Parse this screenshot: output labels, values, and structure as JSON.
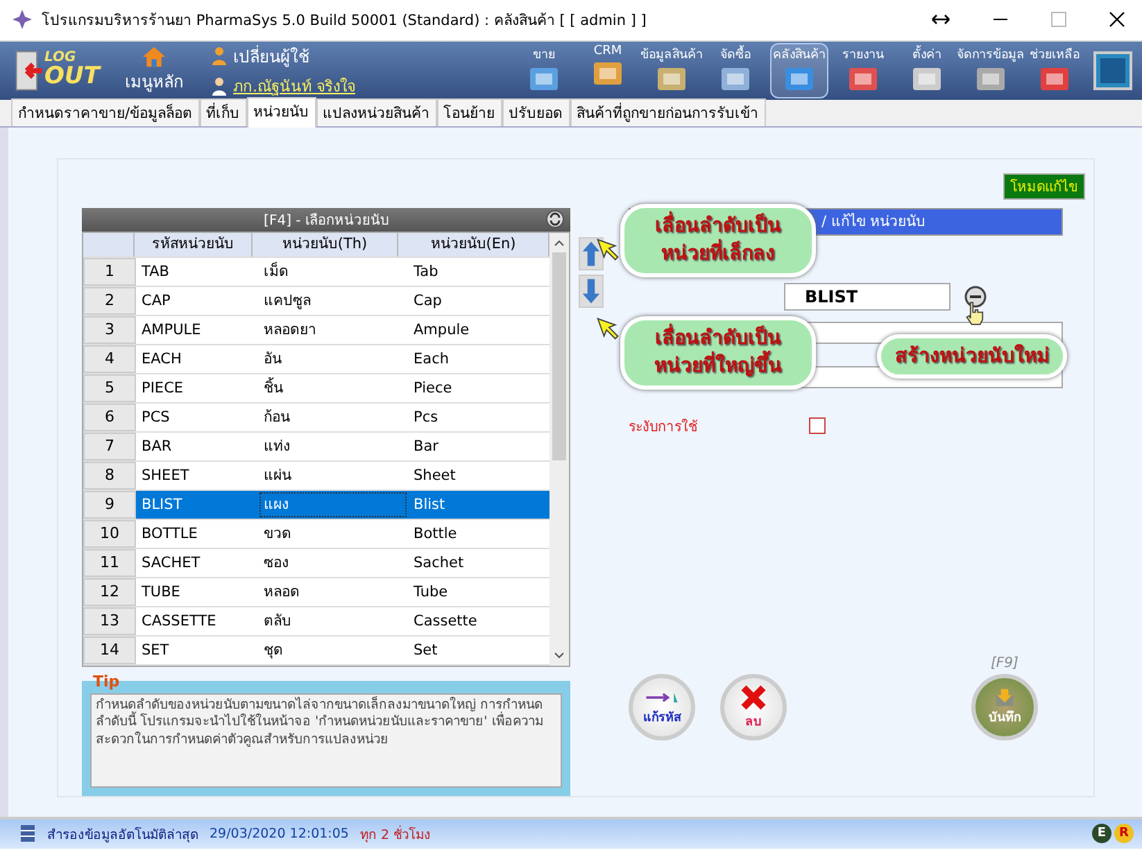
{
  "window": {
    "title": "โปรแกรมบริหารร้านยา PharmaSys 5.0 Build 50001 (Standard) : คลังสินค้า  [ [ admin ] ]"
  },
  "header": {
    "logout_top": "LOG",
    "logout_bottom": "OUT",
    "home": "เมนูหลัก",
    "switch_user": "เปลี่ยนผู้ใช้",
    "user_name": "ภก.ณัฐนันท์ จริงใจ"
  },
  "toolbar": [
    {
      "label": "ขาย",
      "kind": "sale",
      "selected": false
    },
    {
      "label": "CRM",
      "kind": "crm",
      "selected": false
    },
    {
      "label": "ข้อมูลสินค้า",
      "kind": "product",
      "selected": false
    },
    {
      "label": "จัดซื้อ",
      "kind": "purchase",
      "selected": false
    },
    {
      "label": "คลังสินค้า",
      "kind": "stock",
      "selected": true
    },
    {
      "label": "รายงาน",
      "kind": "report",
      "selected": false
    },
    {
      "label": "ตั้งค่า",
      "kind": "settings",
      "selected": false
    },
    {
      "label": "จัดการข้อมูล",
      "kind": "data",
      "selected": false
    },
    {
      "label": "ช่วยเหลือ",
      "kind": "help",
      "selected": false
    }
  ],
  "tabs": [
    {
      "label": "กำหนดราคาขาย/ข้อมูลล็อต",
      "selected": false
    },
    {
      "label": "ที่เก็บ",
      "selected": false
    },
    {
      "label": "หน่วยนับ",
      "selected": true
    },
    {
      "label": "แปลงหน่วยสินค้า",
      "selected": false
    },
    {
      "label": "โอนย้าย",
      "selected": false
    },
    {
      "label": "ปรับยอด",
      "selected": false
    },
    {
      "label": "สินค้าที่ถูกขายก่อนการรับเข้า",
      "selected": false
    }
  ],
  "mode_badge": "โหมดแก้ไข",
  "table": {
    "title": "[F4] - เลือกหน่วยนับ",
    "columns": [
      "รหัสหน่วยนับ",
      "หน่วยนับ(Th)",
      "หน่วยนับ(En)"
    ],
    "rows": [
      {
        "no": "1",
        "code": "TAB",
        "th": "เม็ด",
        "en": "Tab",
        "selected": false
      },
      {
        "no": "2",
        "code": "CAP",
        "th": "แคปซูล",
        "en": "Cap",
        "selected": false
      },
      {
        "no": "3",
        "code": "AMPULE",
        "th": "หลอดยา",
        "en": "Ampule",
        "selected": false
      },
      {
        "no": "4",
        "code": "EACH",
        "th": "อัน",
        "en": "Each",
        "selected": false
      },
      {
        "no": "5",
        "code": "PIECE",
        "th": "ชิ้น",
        "en": "Piece",
        "selected": false
      },
      {
        "no": "6",
        "code": "PCS",
        "th": "ก้อน",
        "en": "Pcs",
        "selected": false
      },
      {
        "no": "7",
        "code": "BAR",
        "th": "แท่ง",
        "en": "Bar",
        "selected": false
      },
      {
        "no": "8",
        "code": "SHEET",
        "th": "แผ่น",
        "en": "Sheet",
        "selected": false
      },
      {
        "no": "9",
        "code": "BLIST",
        "th": "แผง",
        "en": "Blist",
        "selected": true
      },
      {
        "no": "10",
        "code": "BOTTLE",
        "th": "ขวด",
        "en": "Bottle",
        "selected": false
      },
      {
        "no": "11",
        "code": "SACHET",
        "th": "ซอง",
        "en": "Sachet",
        "selected": false
      },
      {
        "no": "12",
        "code": "TUBE",
        "th": "หลอด",
        "en": "Tube",
        "selected": false
      },
      {
        "no": "13",
        "code": "CASSETTE",
        "th": "ตลับ",
        "en": "Cassette",
        "selected": false
      },
      {
        "no": "14",
        "code": "SET",
        "th": "ชุด",
        "en": "Set",
        "selected": false
      }
    ]
  },
  "tip": {
    "title": "Tip",
    "text": "กำหนดลำดับของหน่วยนับตามขนาดไล่จากขนาดเล็กลงมาขนาดใหญ่ การกำหนดลำดับนี้ โปรแกรมจะนำไปใช้ในหน้าจอ 'กำหนดหน่วยนับและราคาขาย' เพื่อความสะดวกในการกำหนดค่าตัวคูณสำหรับการแปลงหน่วย"
  },
  "form": {
    "title": "/ แก้ไข หน่วยนับ",
    "code_value": "BLIST",
    "disable_label": "ระงับการใช้",
    "disabled_checked": false
  },
  "callouts": [
    "เลื่อนลำดับเป็นหน่วยที่เล็กลง",
    "เลื่อนลำดับเป็นหน่วยที่ใหญ่ขึ้น",
    "สร้างหน่วยนับใหม่"
  ],
  "buttons": {
    "rename": "แก้รหัส",
    "delete": "ลบ",
    "save_hotkey": "[F9]",
    "save": "บันทึก"
  },
  "status_bar": {
    "label": "สำรองข้อมูลอัตโนมัติล่าสุด",
    "datetime": "29/03/2020 12:01:05",
    "interval": "ทุก 2 ชั่วโมง",
    "badges": [
      "E",
      "R"
    ]
  }
}
